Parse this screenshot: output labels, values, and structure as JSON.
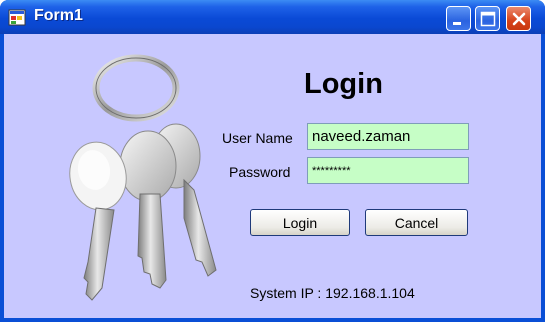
{
  "window": {
    "title": "Form1",
    "controls": {
      "minimize": "minimize-icon",
      "maximize": "maximize-icon",
      "close": "close-icon"
    }
  },
  "form": {
    "heading": "Login",
    "username": {
      "label": "User Name",
      "value": "naveed.zaman"
    },
    "password": {
      "label": "Password",
      "value": "*********"
    },
    "login_button": "Login",
    "cancel_button": "Cancel"
  },
  "status": {
    "system_ip": "System IP : 192.168.1.104"
  },
  "colors": {
    "client_bg": "#c8c8ff",
    "input_bg": "#c6fec6",
    "titlebar": "#0a4ad6"
  }
}
